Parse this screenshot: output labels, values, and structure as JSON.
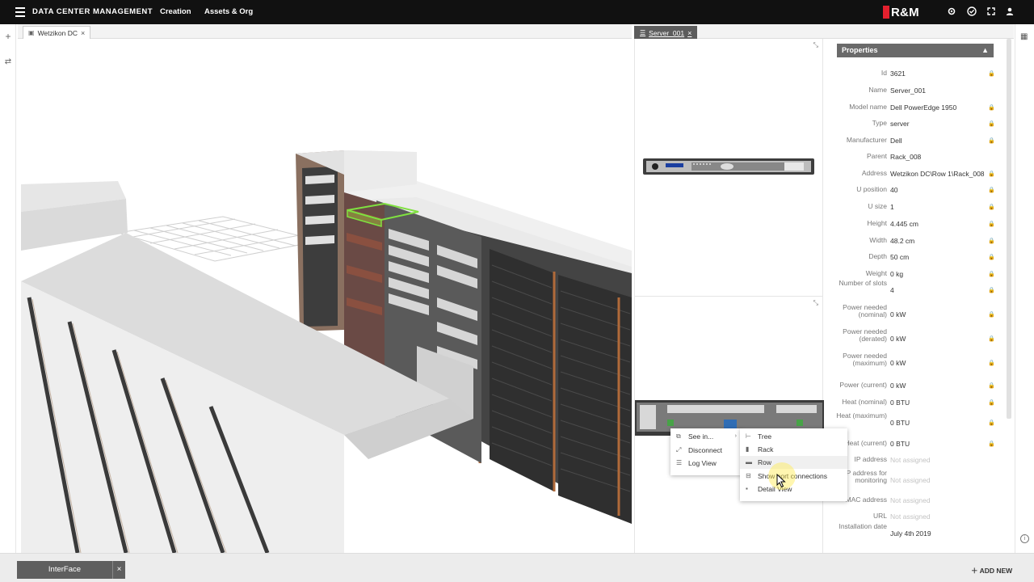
{
  "topbar": {
    "app_title": "DATA CENTER MANAGEMENT",
    "nav": [
      "Creation",
      "Assets & Org"
    ],
    "brand": "R&M",
    "icons": [
      "gear-icon",
      "check-circle-icon",
      "fullscreen-icon",
      "user-icon"
    ]
  },
  "tabs_left": [
    {
      "label": "Wetzikon DC",
      "close": "×"
    }
  ],
  "tabs_right": [
    {
      "label": "Server_001",
      "close": "×"
    }
  ],
  "properties": {
    "title": "Properties",
    "rows": [
      {
        "label": "Id",
        "value": "3621",
        "locked": true
      },
      {
        "label": "Name",
        "value": "Server_001",
        "locked": false
      },
      {
        "label": "Model name",
        "value": "Dell PowerEdge 1950",
        "locked": true
      },
      {
        "label": "Type",
        "value": "server",
        "locked": true
      },
      {
        "label": "Manufacturer",
        "value": "Dell",
        "locked": true
      },
      {
        "label": "Parent",
        "value": "Rack_008",
        "locked": false
      },
      {
        "label": "Address",
        "value": "Wetzikon DC\\Row 1\\Rack_008",
        "locked": true
      },
      {
        "label": "U position",
        "value": "40",
        "locked": true
      },
      {
        "label": "U size",
        "value": "1",
        "locked": true
      },
      {
        "label": "Height",
        "value": "4.445 cm",
        "locked": true
      },
      {
        "label": "Width",
        "value": "48.2 cm",
        "locked": true
      },
      {
        "label": "Depth",
        "value": "50 cm",
        "locked": true
      },
      {
        "label": "Weight",
        "value": "0 kg",
        "locked": true
      },
      {
        "label": "Number of slots",
        "value": "4",
        "locked": true
      },
      {
        "label": "Power needed (nominal)",
        "value": "0 kW",
        "locked": true
      },
      {
        "label": "Power needed (derated)",
        "value": "0 kW",
        "locked": true
      },
      {
        "label": "Power needed (maximum)",
        "value": "0 kW",
        "locked": true
      },
      {
        "label": "Power (current)",
        "value": "0 kW",
        "locked": true
      },
      {
        "label": "Heat (nominal)",
        "value": "0 BTU",
        "locked": true
      },
      {
        "label": "Heat (maximum)",
        "value": "0 BTU",
        "locked": true
      },
      {
        "label": "Heat (current)",
        "value": "0 BTU",
        "locked": true
      },
      {
        "label": "IP address",
        "value": "Not assigned",
        "locked": false
      },
      {
        "label": "IP address for monitoring",
        "value": "Not assigned",
        "locked": false
      },
      {
        "label": "MAC address",
        "value": "Not assigned",
        "locked": false
      },
      {
        "label": "URL",
        "value": "Not assigned",
        "locked": false
      },
      {
        "label": "Installation date",
        "value": "July 4th 2019",
        "locked": false
      }
    ]
  },
  "context_menu": {
    "items": [
      {
        "label": "See in...",
        "icon": "external-link-icon",
        "has_submenu": true
      },
      {
        "label": "Disconnect",
        "icon": "disconnect-icon"
      },
      {
        "label": "Log View",
        "icon": "list-icon"
      }
    ]
  },
  "submenu": {
    "items": [
      {
        "label": "Tree",
        "icon": "tree-icon"
      },
      {
        "label": "Rack",
        "icon": "rack-icon"
      },
      {
        "label": "Row",
        "icon": "row-icon",
        "hover": true
      },
      {
        "label": "Show port connections",
        "icon": "port-icon"
      },
      {
        "label": "Detail View",
        "icon": "detail-icon"
      }
    ]
  },
  "bottombar": {
    "interface_label": "InterFace",
    "interface_close": "×",
    "add_new": "ADD NEW"
  },
  "colors": {
    "topbar": "#111111",
    "brand_red": "#e4202e",
    "panel_header": "#6a6a6a",
    "selection_green": "#7fe040"
  }
}
